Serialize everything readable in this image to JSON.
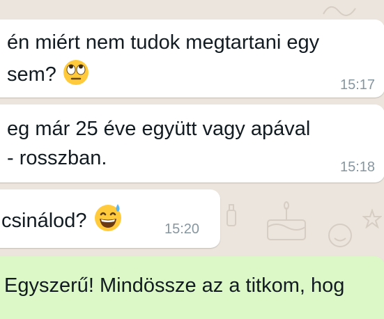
{
  "colors": {
    "wallpaper": "#ece5dd",
    "incoming_bubble": "#ffffff",
    "outgoing_bubble": "#dcf8c6",
    "time_text": "#8696a0",
    "message_text": "#111b21"
  },
  "messages": [
    {
      "direction": "incoming",
      "lines": [
        "én miért nem tudok megtartani egy",
        "sem?"
      ],
      "emoji": "face-with-rolling-eyes",
      "time": "15:17"
    },
    {
      "direction": "incoming",
      "lines": [
        "eg már 25 éve együtt vagy apával",
        "- rosszban."
      ],
      "time": "15:18"
    },
    {
      "direction": "incoming",
      "lines": [
        "csinálod?"
      ],
      "emoji": "grinning-face-with-sweat",
      "time": "15:20"
    },
    {
      "direction": "outgoing",
      "lines": [
        "Egyszerű! Mindössze az a titkom, hog"
      ]
    }
  ]
}
